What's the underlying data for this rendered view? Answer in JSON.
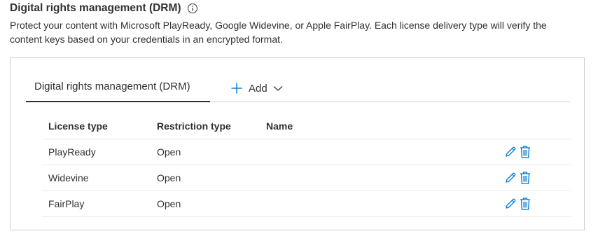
{
  "section": {
    "title": "Digital rights management (DRM)",
    "info_icon": "info-icon",
    "description": "Protect your content with Microsoft PlayReady, Google Widevine, or Apple FairPlay. Each license delivery type will verify the content keys based on your credentials in an encrypted format."
  },
  "tabs": {
    "active_label": "Digital rights management (DRM)",
    "add_label": "Add",
    "add_icon": "plus-icon",
    "add_dropdown_icon": "chevron-down-icon"
  },
  "table": {
    "headers": {
      "license_type": "License type",
      "restriction_type": "Restriction type",
      "name": "Name"
    },
    "rows": [
      {
        "license_type": "PlayReady",
        "restriction_type": "Open",
        "name": ""
      },
      {
        "license_type": "Widevine",
        "restriction_type": "Open",
        "name": ""
      },
      {
        "license_type": "FairPlay",
        "restriction_type": "Open",
        "name": ""
      }
    ],
    "row_actions": [
      "edit-icon",
      "delete-icon"
    ]
  },
  "colors": {
    "accent": "#0078d4",
    "text": "#323130",
    "border": "#d2d0ce"
  }
}
